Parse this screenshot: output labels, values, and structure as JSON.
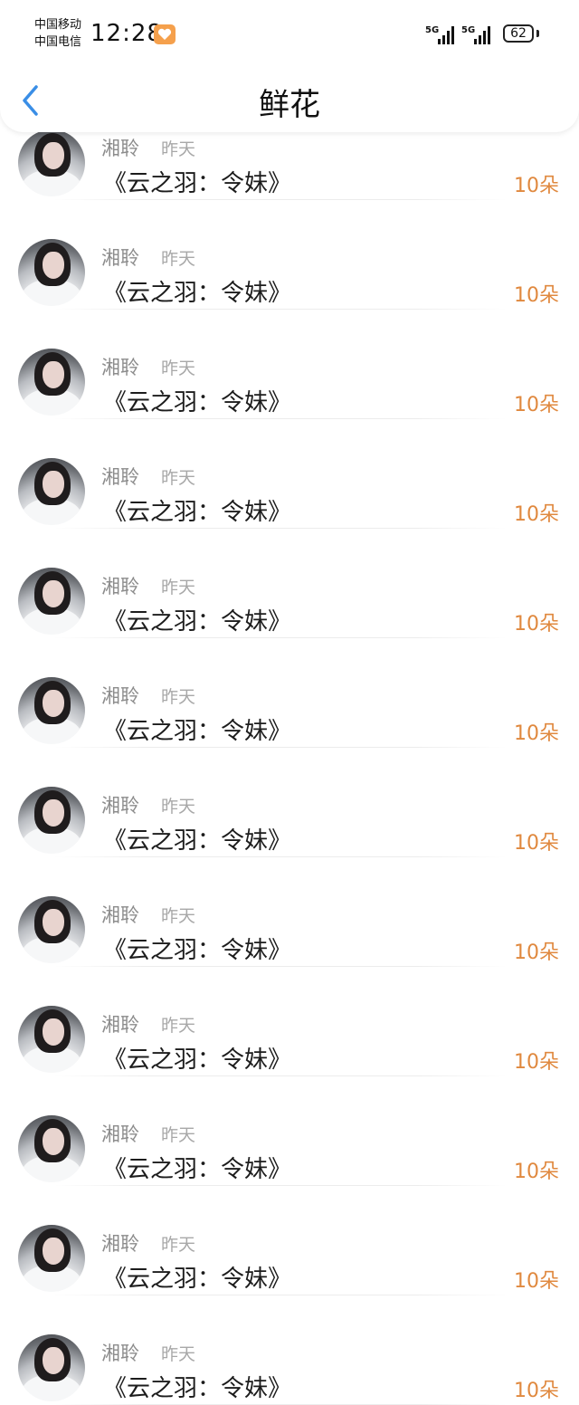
{
  "status_bar": {
    "carrier_1": "中国移动",
    "carrier_2": "中国电信",
    "time": "12:28",
    "network_1": "5G",
    "network_2": "5G",
    "battery": "62"
  },
  "header": {
    "title": "鲜花",
    "back_icon": "chevron-left-icon"
  },
  "colors": {
    "amount": "#e0893f",
    "back_icon": "#3a8ee6",
    "name": "#8c8c8c"
  },
  "gifts": [
    {
      "name": "湘聆",
      "date": "昨天",
      "work": "《云之羽：令妹》",
      "amount": "10朵"
    },
    {
      "name": "湘聆",
      "date": "昨天",
      "work": "《云之羽：令妹》",
      "amount": "10朵"
    },
    {
      "name": "湘聆",
      "date": "昨天",
      "work": "《云之羽：令妹》",
      "amount": "10朵"
    },
    {
      "name": "湘聆",
      "date": "昨天",
      "work": "《云之羽：令妹》",
      "amount": "10朵"
    },
    {
      "name": "湘聆",
      "date": "昨天",
      "work": "《云之羽：令妹》",
      "amount": "10朵"
    },
    {
      "name": "湘聆",
      "date": "昨天",
      "work": "《云之羽：令妹》",
      "amount": "10朵"
    },
    {
      "name": "湘聆",
      "date": "昨天",
      "work": "《云之羽：令妹》",
      "amount": "10朵"
    },
    {
      "name": "湘聆",
      "date": "昨天",
      "work": "《云之羽：令妹》",
      "amount": "10朵"
    },
    {
      "name": "湘聆",
      "date": "昨天",
      "work": "《云之羽：令妹》",
      "amount": "10朵"
    },
    {
      "name": "湘聆",
      "date": "昨天",
      "work": "《云之羽：令妹》",
      "amount": "10朵"
    },
    {
      "name": "湘聆",
      "date": "昨天",
      "work": "《云之羽：令妹》",
      "amount": "10朵"
    },
    {
      "name": "湘聆",
      "date": "昨天",
      "work": "《云之羽：令妹》",
      "amount": "10朵"
    }
  ]
}
